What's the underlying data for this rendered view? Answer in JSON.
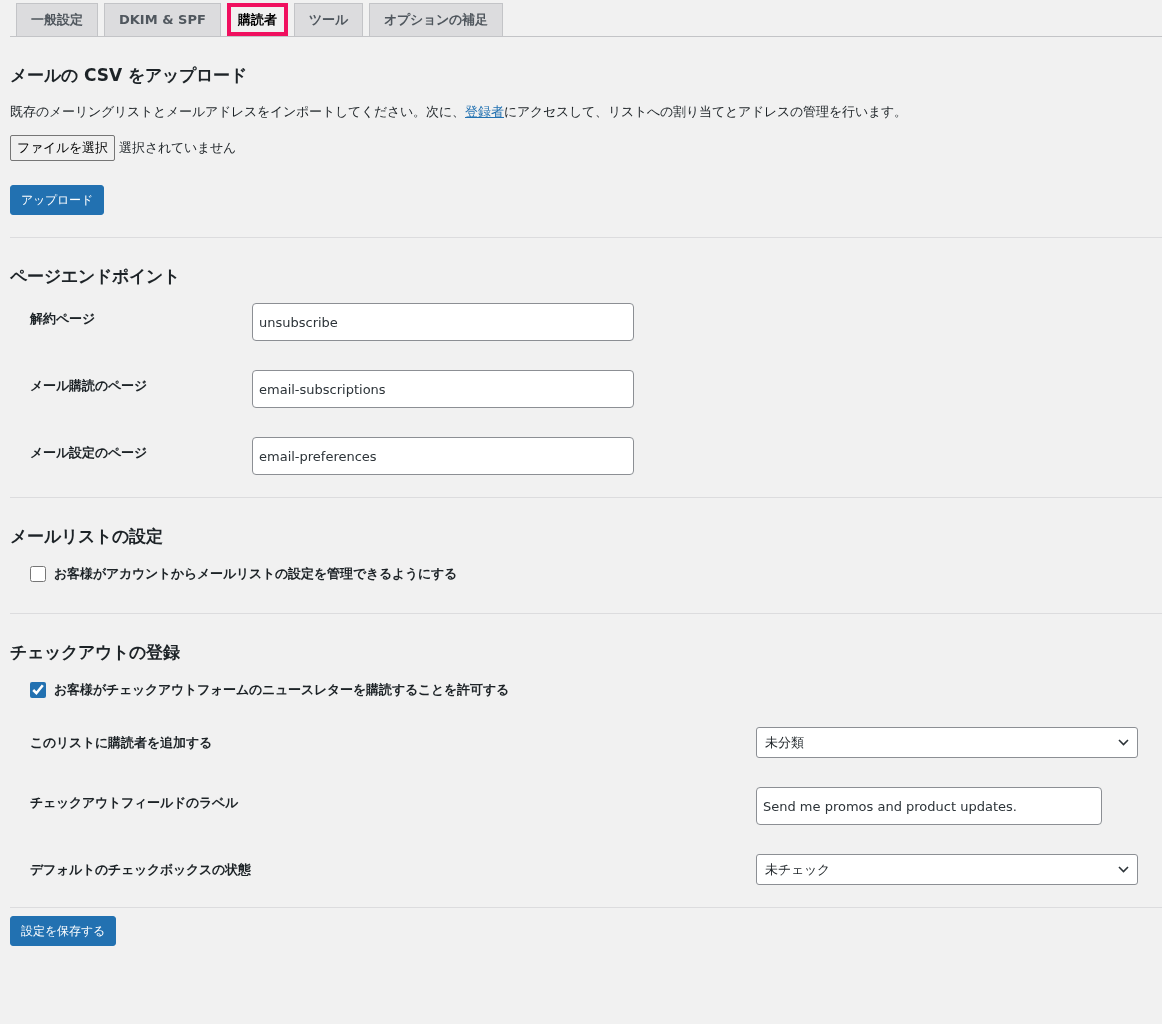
{
  "tabs": [
    {
      "label": "一般設定",
      "selected": false,
      "highlighted": false
    },
    {
      "label": "DKIM & SPF",
      "selected": false,
      "highlighted": false
    },
    {
      "label": "購読者",
      "selected": true,
      "highlighted": true
    },
    {
      "label": "ツール",
      "selected": false,
      "highlighted": false
    },
    {
      "label": "オプションの補足",
      "selected": false,
      "highlighted": false
    }
  ],
  "sections": [
    {
      "title": "メールの CSV をアップロード",
      "rows": [
        {
          "kind": "description",
          "before": "既存のメーリングリストとメールアドレスをインポートしてください。次に、",
          "link": "登録者",
          "after": "にアクセスして、リストへの割り当てとアドレスの管理を行います。"
        },
        {
          "kind": "file",
          "button": "ファイルを選択",
          "status": "選択されていません"
        },
        {
          "kind": "button",
          "label": "アップロード"
        }
      ]
    },
    {
      "title": "ページエンドポイント",
      "rows": [
        {
          "kind": "text",
          "label": "解約ページ",
          "value": "unsubscribe"
        },
        {
          "kind": "text",
          "label": "メール購読のページ",
          "value": "email-subscriptions"
        },
        {
          "kind": "text",
          "label": "メール設定のページ",
          "value": "email-preferences"
        }
      ]
    },
    {
      "title": "メールリストの設定",
      "rows": [
        {
          "kind": "checkbox",
          "label": "お客様がアカウントからメールリストの設定を管理できるようにする",
          "checked": false
        }
      ]
    },
    {
      "title": "チェックアウトの登録",
      "rows": [
        {
          "kind": "checkbox",
          "label": "お客様がチェックアウトフォームのニュースレターを購読することを許可する",
          "checked": true
        },
        {
          "kind": "select",
          "label": "このリストに購読者を追加する",
          "value": "未分類"
        },
        {
          "kind": "wide-text",
          "label": "チェックアウトフィールドのラベル",
          "value": "Send me promos and product updates."
        },
        {
          "kind": "select",
          "label": "デフォルトのチェックボックスの状態",
          "value": "未チェック"
        }
      ]
    }
  ],
  "save_button": "設定を保存する"
}
